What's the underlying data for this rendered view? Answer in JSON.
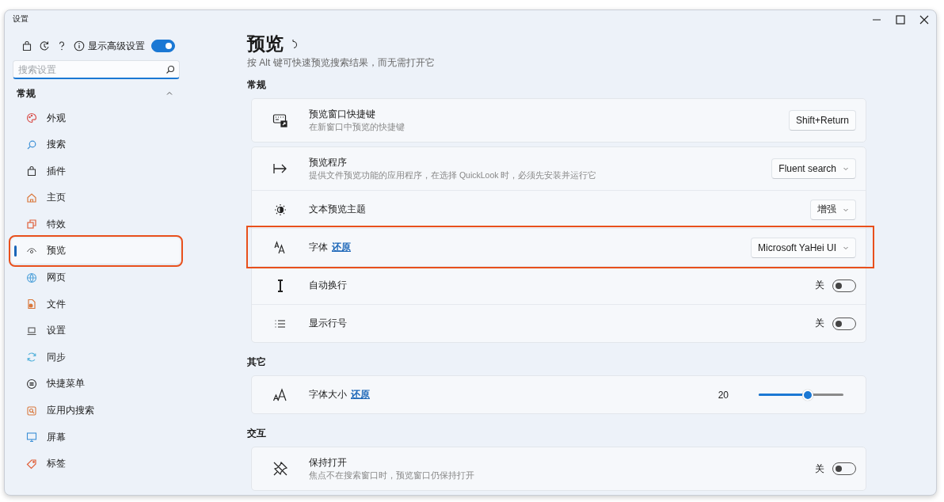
{
  "window": {
    "title": "设置"
  },
  "sidebar": {
    "advanced": {
      "label": "显示高级设置",
      "on": true
    },
    "search": {
      "placeholder": "搜索设置"
    },
    "group": {
      "title": "常规",
      "expanded": true
    },
    "items": [
      {
        "label": "外观",
        "selected": false,
        "highlighted": false
      },
      {
        "label": "搜索",
        "selected": false,
        "highlighted": false
      },
      {
        "label": "插件",
        "selected": false,
        "highlighted": false
      },
      {
        "label": "主页",
        "selected": false,
        "highlighted": false
      },
      {
        "label": "特效",
        "selected": false,
        "highlighted": false
      },
      {
        "label": "预览",
        "selected": true,
        "highlighted": true
      },
      {
        "label": "网页",
        "selected": false,
        "highlighted": false
      },
      {
        "label": "文件",
        "selected": false,
        "highlighted": false
      },
      {
        "label": "设置",
        "selected": false,
        "highlighted": false
      },
      {
        "label": "同步",
        "selected": false,
        "highlighted": false
      },
      {
        "label": "快捷菜单",
        "selected": false,
        "highlighted": false
      },
      {
        "label": "应用内搜索",
        "selected": false,
        "highlighted": false
      },
      {
        "label": "屏幕",
        "selected": false,
        "highlighted": false
      },
      {
        "label": "标签",
        "selected": false,
        "highlighted": false
      }
    ]
  },
  "page": {
    "title": "预览",
    "subtitle": "按 Alt 键可快速预览搜索结果，而无需打开它",
    "sections": [
      {
        "title": "常规",
        "cards": [
          {
            "rows": [
              {
                "kind": "shortcut",
                "title": "预览窗口快捷键",
                "description": "在新窗口中预览的快捷键",
                "value": "Shift+Return",
                "highlighted": false
              }
            ]
          },
          {
            "rows": [
              {
                "kind": "dropdown",
                "title": "预览程序",
                "description": "提供文件预览功能的应用程序，在选择 QuickLook 时，必须先安装并运行它",
                "value": "Fluent search",
                "highlighted": false
              },
              {
                "kind": "dropdown",
                "title": "文本预览主题",
                "value": "增强",
                "highlighted": false
              },
              {
                "kind": "dropdown",
                "title": "字体",
                "reset": "还原",
                "value": "Microsoft YaHei UI",
                "highlighted": true
              },
              {
                "kind": "toggle",
                "title": "自动换行",
                "state_label": "关",
                "on": false,
                "highlighted": false
              },
              {
                "kind": "toggle",
                "title": "显示行号",
                "state_label": "关",
                "on": false,
                "highlighted": false
              }
            ]
          }
        ]
      },
      {
        "title": "其它",
        "cards": [
          {
            "rows": [
              {
                "kind": "slider",
                "title": "字体大小",
                "reset": "还原",
                "value": "20",
                "level": 0.56,
                "highlighted": false
              }
            ]
          }
        ]
      },
      {
        "title": "交互",
        "cards": [
          {
            "rows": [
              {
                "kind": "toggle",
                "title": "保持打开",
                "description": "焦点不在搜索窗口时，预览窗口仍保持打开",
                "state_label": "关",
                "on": false,
                "highlighted": false
              }
            ]
          }
        ]
      }
    ]
  }
}
